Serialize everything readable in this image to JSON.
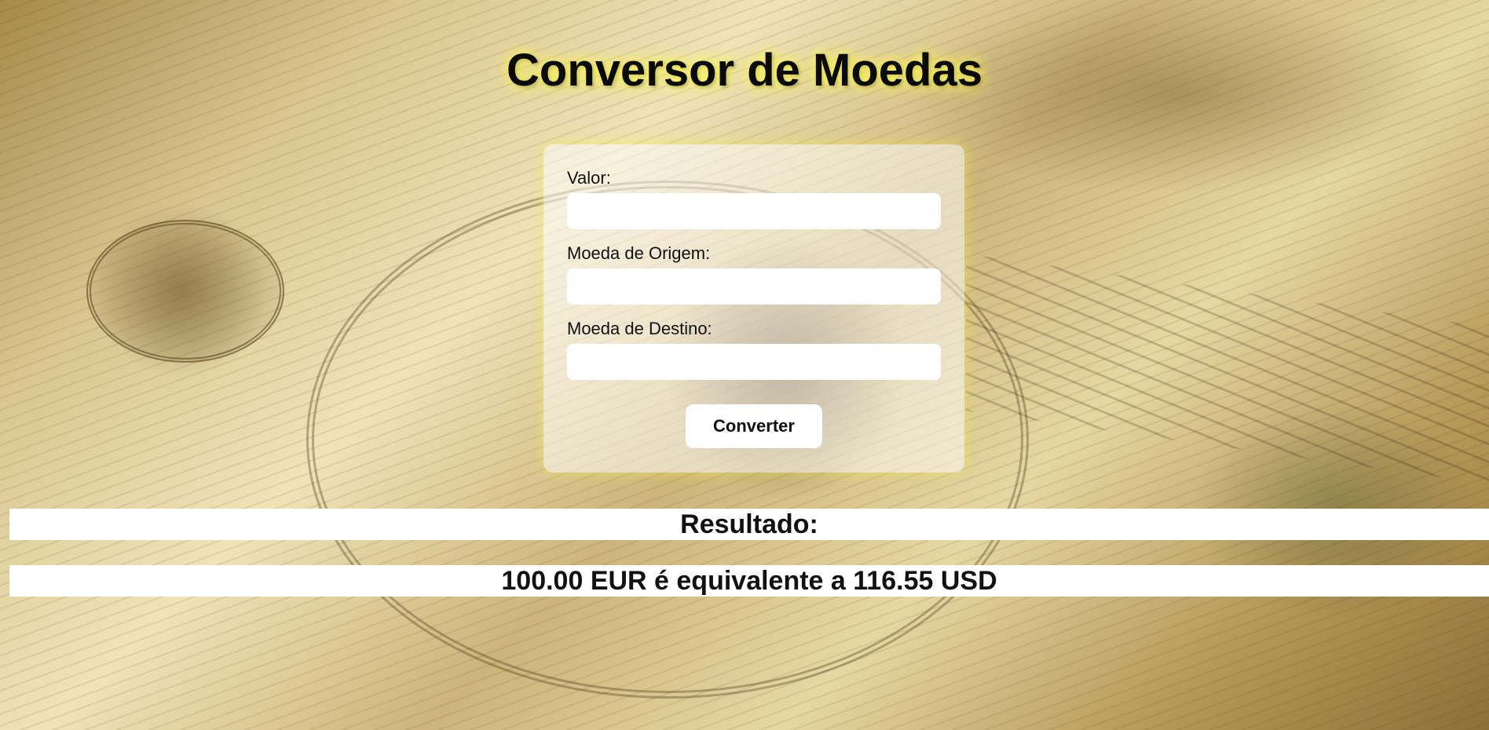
{
  "page": {
    "title": "Conversor de Moedas"
  },
  "form": {
    "amount_label": "Valor:",
    "amount_value": "",
    "source_currency_label": "Moeda de Origem:",
    "source_currency_value": "",
    "target_currency_label": "Moeda de Destino:",
    "target_currency_value": "",
    "convert_button_label": "Converter"
  },
  "result": {
    "heading": "Resultado:",
    "text": "100.00 EUR é equivalente a 116.55 USD"
  },
  "colors": {
    "title_glow": "#fff95a",
    "card_background": "rgba(255,255,255,0.52)",
    "input_background": "#ffffff",
    "result_background": "#ffffff"
  }
}
